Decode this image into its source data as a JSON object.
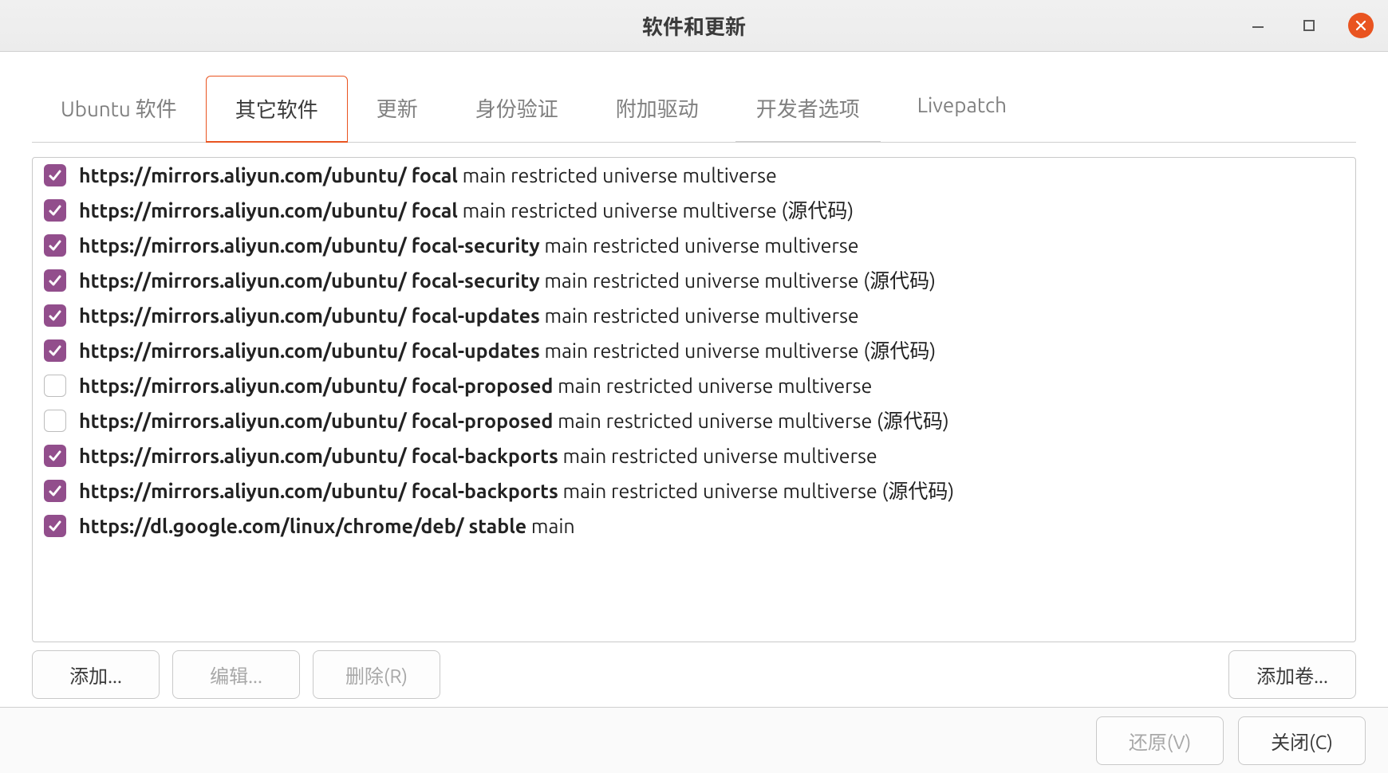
{
  "window": {
    "title": "软件和更新"
  },
  "tabs": [
    {
      "label": "Ubuntu 软件",
      "active": false
    },
    {
      "label": "其它软件",
      "active": true
    },
    {
      "label": "更新",
      "active": false
    },
    {
      "label": "身份验证",
      "active": false
    },
    {
      "label": "附加驱动",
      "active": false
    },
    {
      "label": "开发者选项",
      "active": false,
      "underline": true
    },
    {
      "label": "Livepatch",
      "active": false
    }
  ],
  "sources": [
    {
      "checked": true,
      "bold": "https://mirrors.aliyun.com/ubuntu/ focal",
      "rest": " main restricted universe multiverse"
    },
    {
      "checked": true,
      "bold": "https://mirrors.aliyun.com/ubuntu/ focal",
      "rest": " main restricted universe multiverse (源代码)"
    },
    {
      "checked": true,
      "bold": "https://mirrors.aliyun.com/ubuntu/ focal-security",
      "rest": " main restricted universe multiverse"
    },
    {
      "checked": true,
      "bold": "https://mirrors.aliyun.com/ubuntu/ focal-security",
      "rest": " main restricted universe multiverse (源代码)"
    },
    {
      "checked": true,
      "bold": "https://mirrors.aliyun.com/ubuntu/ focal-updates",
      "rest": " main restricted universe multiverse"
    },
    {
      "checked": true,
      "bold": "https://mirrors.aliyun.com/ubuntu/ focal-updates",
      "rest": " main restricted universe multiverse (源代码)"
    },
    {
      "checked": false,
      "bold": "https://mirrors.aliyun.com/ubuntu/ focal-proposed",
      "rest": " main restricted universe multiverse"
    },
    {
      "checked": false,
      "bold": "https://mirrors.aliyun.com/ubuntu/ focal-proposed",
      "rest": " main restricted universe multiverse (源代码)"
    },
    {
      "checked": true,
      "bold": "https://mirrors.aliyun.com/ubuntu/ focal-backports",
      "rest": " main restricted universe multiverse"
    },
    {
      "checked": true,
      "bold": "https://mirrors.aliyun.com/ubuntu/ focal-backports",
      "rest": " main restricted universe multiverse (源代码)"
    },
    {
      "checked": true,
      "bold": "https://dl.google.com/linux/chrome/deb/ stable",
      "rest": " main"
    }
  ],
  "toolbar": {
    "add": "添加...",
    "edit": "编辑...",
    "remove": "删除(R)",
    "add_volume": "添加卷..."
  },
  "footer": {
    "revert": "还原(V)",
    "close": "关闭(C)"
  },
  "colors": {
    "accent": "#e95420",
    "checkbox": "#924e8c"
  }
}
